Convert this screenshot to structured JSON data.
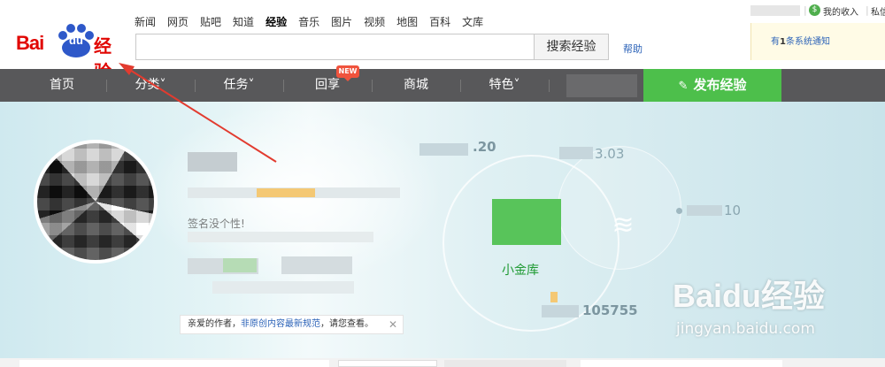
{
  "logo": {
    "bai": "Bai",
    "du": "du",
    "suffix": "经验"
  },
  "nav_links": [
    "新闻",
    "网页",
    "贴吧",
    "知道",
    "经验",
    "音乐",
    "图片",
    "视频",
    "地图",
    "百科",
    "文库"
  ],
  "nav_links_active": "经验",
  "search": {
    "placeholder": "",
    "button": "搜索经验",
    "help": "帮助"
  },
  "top_right": {
    "income": "我的收入",
    "message": "私信",
    "notice_prefix": "有",
    "notice_count": "1",
    "notice_suffix": "条系统通知"
  },
  "main_nav": {
    "items": [
      "首页",
      "分类˅",
      "任务˅",
      "回享",
      "商城",
      "特色˅"
    ],
    "new_badge": "NEW",
    "publish": "发布经验"
  },
  "profile": {
    "signature": "签名没个性!",
    "tip_prefix": "亲爱的作者，",
    "tip_link": "非原创内容最新规范",
    "tip_suffix": "，请您查看。",
    "tip_close": "✕"
  },
  "stats": {
    "top_value": ".20",
    "second_value": "3.03",
    "third_value": "10",
    "bottom_value": "105755",
    "jinku_label": "小金库"
  },
  "watermark": {
    "logo_text": "Baidu经验",
    "url": "jingyan.baidu.com"
  },
  "colors": {
    "brand_red": "#e10602",
    "nav_bg": "#58585a",
    "publish_green": "#4dbf4b",
    "link_blue": "#2c63b8"
  },
  "icons": {
    "money": "money-icon",
    "pen": "pen-icon",
    "layers": "layers-icon",
    "close": "close-icon"
  }
}
